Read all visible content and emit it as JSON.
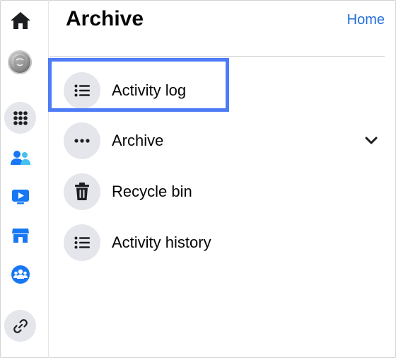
{
  "header": {
    "title": "Archive",
    "home_link": "Home"
  },
  "sidebar": {
    "items": [
      {
        "name": "home",
        "icon": "home-icon"
      },
      {
        "name": "profile",
        "icon": "avatar"
      },
      {
        "name": "menu",
        "icon": "grid-dots-icon"
      },
      {
        "name": "friends",
        "icon": "friends-icon"
      },
      {
        "name": "watch",
        "icon": "video-play-icon"
      },
      {
        "name": "marketplace",
        "icon": "store-icon"
      },
      {
        "name": "groups",
        "icon": "groups-icon"
      },
      {
        "name": "links",
        "icon": "link-icon"
      }
    ]
  },
  "menu": {
    "items": [
      {
        "label": "Activity log",
        "icon": "list-icon",
        "highlighted": true
      },
      {
        "label": "Archive",
        "icon": "more-dots-icon",
        "expandable": true
      },
      {
        "label": "Recycle bin",
        "icon": "trash-icon"
      },
      {
        "label": "Activity history",
        "icon": "list-icon"
      }
    ]
  },
  "colors": {
    "accent": "#216fdb",
    "highlight_box": "#4e7bf6",
    "icon_bg": "#e4e6eb",
    "text": "#050505",
    "rail_icon_blue": "#1877f2"
  }
}
